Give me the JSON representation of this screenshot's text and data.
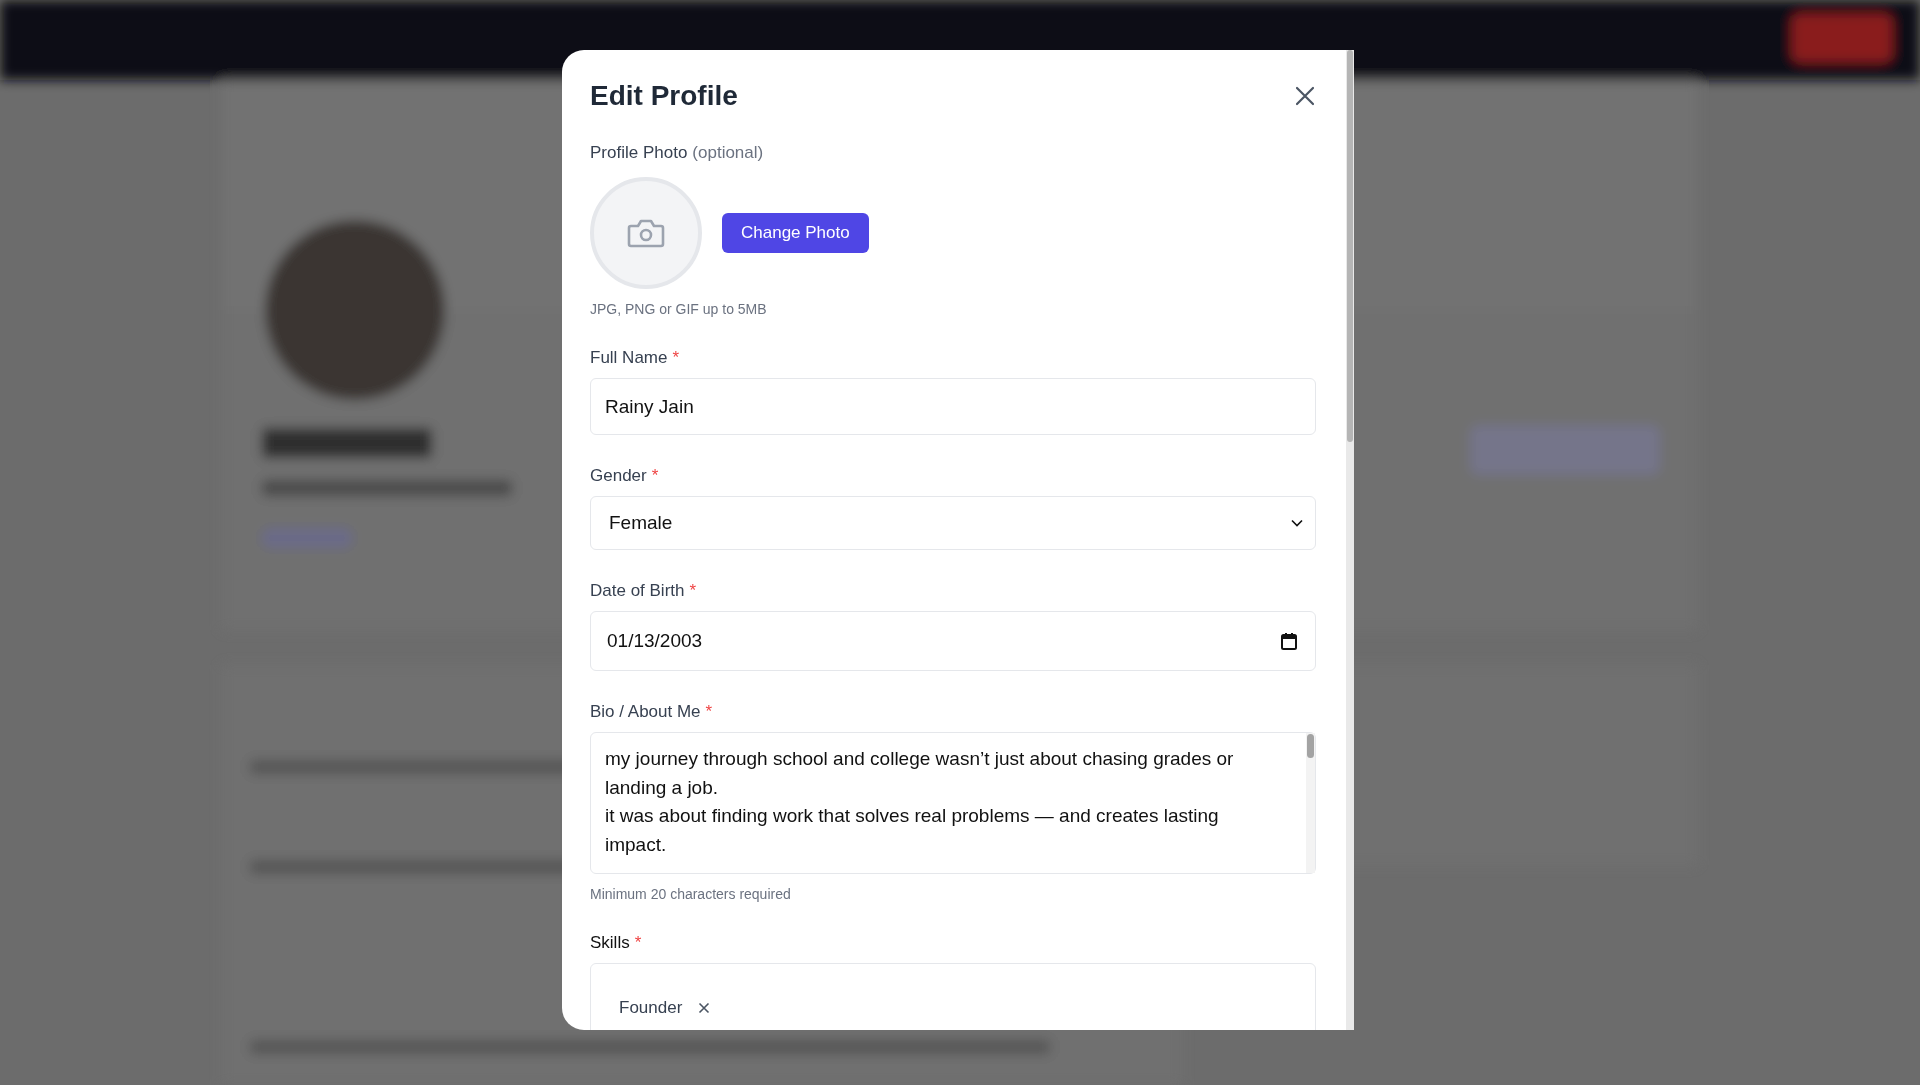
{
  "dialog": {
    "title": "Edit Profile",
    "required_mark": "*",
    "photo": {
      "label": "Profile Photo",
      "label_note": "(optional)",
      "button": "Change Photo",
      "hint": "JPG, PNG or GIF up to 5MB"
    },
    "fields": [
      {
        "kind": "text",
        "label": "Full Name",
        "required": true,
        "value": "Rainy Jain"
      },
      {
        "kind": "select",
        "label": "Gender",
        "required": true,
        "value": "Female"
      },
      {
        "kind": "date",
        "label": "Date of Birth",
        "required": true,
        "value": "01/13/2003"
      },
      {
        "kind": "textarea",
        "label": "Bio / About Me",
        "required": true,
        "value": "my journey through school and college wasn’t just about chasing grades or landing a job.\nit was about finding work that solves real problems — and creates lasting impact.",
        "hint": "Minimum 20 characters required"
      },
      {
        "kind": "tags",
        "label": "Skills",
        "required": true,
        "tags": [
          "Founder"
        ]
      }
    ]
  }
}
